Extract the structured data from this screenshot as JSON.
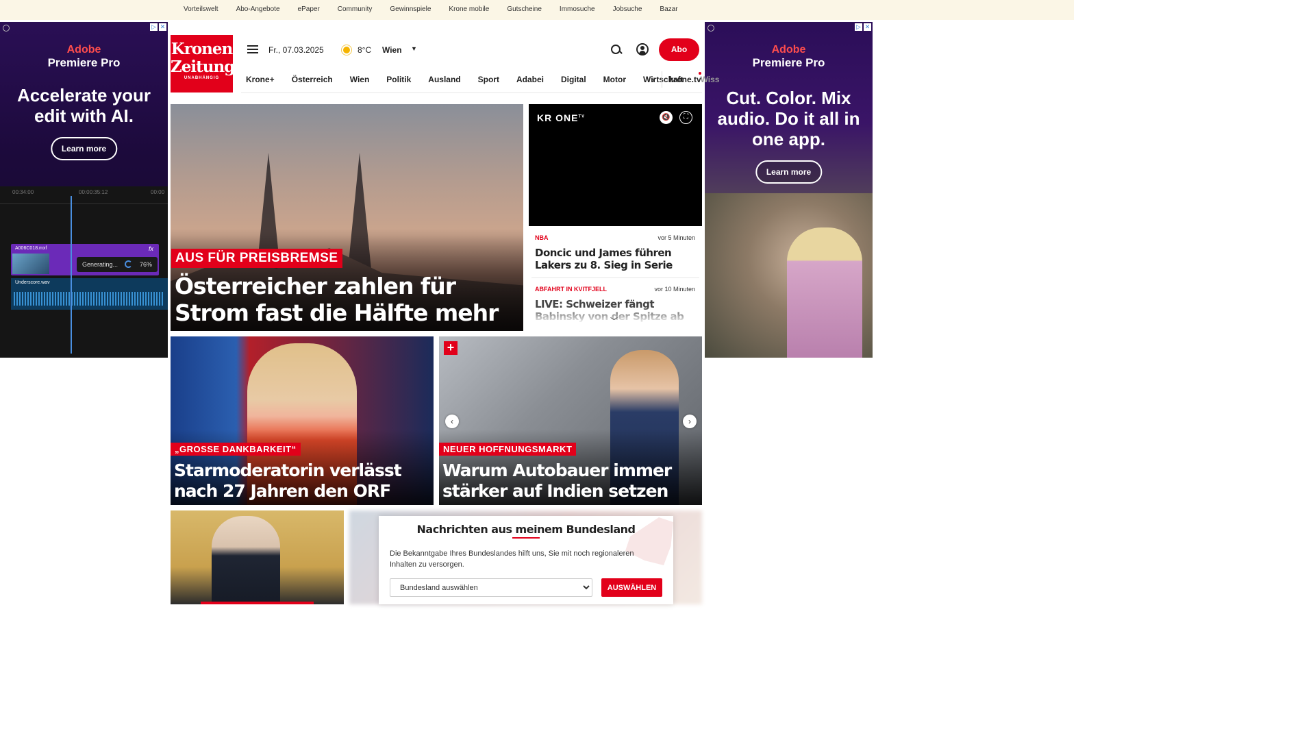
{
  "utility_nav": [
    "Vorteilswelt",
    "Abo-Angebote",
    "ePaper",
    "Community",
    "Gewinnspiele",
    "Krone mobile",
    "Gutscheine",
    "Immosuche",
    "Jobsuche",
    "Bazar"
  ],
  "ad_left": {
    "brand": "Adobe",
    "product": "Premiere Pro",
    "headline": "Accelerate your edit with AI.",
    "cta": "Learn more",
    "ruler_times": [
      "00:34:00",
      "00:00:35:12",
      "00:00"
    ],
    "video_clip": "A006C018.mxf",
    "fx": "fx",
    "audio_clip": "Underscore.wav",
    "generating_label": "Generating...",
    "generating_pct": "76%",
    "generating_progress": 0.76
  },
  "ad_right": {
    "brand": "Adobe",
    "product": "Premiere Pro",
    "headline": "Cut. Color. Mix audio. Do it all in one app.",
    "cta": "Learn more"
  },
  "header": {
    "logo_line1": "Kronen",
    "logo_line2": "Zeitung",
    "logo_tagline": "UNABHÄNGIG",
    "date": "Fr., 07.03.2025",
    "temperature": "8°C",
    "city": "Wien",
    "abo_label": "Abo"
  },
  "nav": {
    "items": [
      "Krone+",
      "Österreich",
      "Wien",
      "Politik",
      "Ausland",
      "Sport",
      "Adabei",
      "Digital",
      "Motor",
      "Wirtschaft"
    ],
    "partial": "Wiss",
    "tv": "krone.tv"
  },
  "hero": {
    "kicker": "AUS FÜR PREISBREMSE",
    "title": "Österreicher zahlen für Strom fast die Hälfte mehr"
  },
  "video": {
    "logo": "KR ONE",
    "logo_sup": "TV"
  },
  "ticker": [
    {
      "category": "NBA",
      "time": "vor 5 Minuten",
      "title": "Doncic und James führen Lakers zu 8. Sieg in Serie"
    },
    {
      "category": "ABFAHRT IN KVITFJELL",
      "time": "vor 10 Minuten",
      "title": "LIVE: Schweizer fängt Babinsky von der Spitze ab"
    }
  ],
  "cards": [
    {
      "kicker": "„GROSSE DANKBARKEIT“",
      "title": "Starmoderatorin verlässt nach 27 Jahren den ORF"
    },
    {
      "kicker": "NEUER HOFFNUNGSMARKT",
      "title": "Warum Autobauer immer stärker auf Indien setzen"
    }
  ],
  "modal": {
    "title": "Nachrichten aus meinem Bundesland",
    "description": "Die Bekanntgabe Ihres Bundeslandes hilft uns, Sie mit noch regionaleren Inhalten zu versorgen.",
    "select_placeholder": "Bundesland auswählen",
    "button": "AUSWÄHLEN"
  },
  "colors": {
    "brand_red": "#e2001a",
    "utility_bg": "#fbf6e6",
    "ad_purple": "#2a0f55"
  }
}
